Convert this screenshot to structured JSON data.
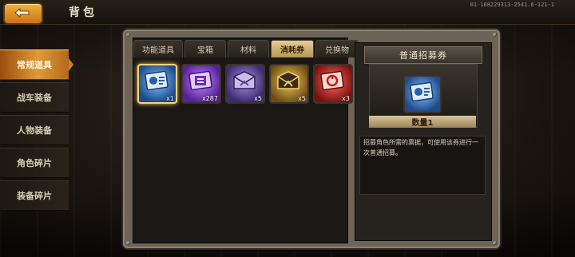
{
  "header": {
    "title": "背包",
    "server_id": "01-108229313-2541.6-121-1",
    "back_icon": "back-arrow-icon"
  },
  "sidebar": {
    "items": [
      {
        "label": "常规道具",
        "active": true
      },
      {
        "label": "战车装备",
        "active": false
      },
      {
        "label": "人物装备",
        "active": false
      },
      {
        "label": "角色碎片",
        "active": false
      },
      {
        "label": "装备碎片",
        "active": false
      }
    ]
  },
  "tabs": [
    {
      "label": "功能道具",
      "active": false
    },
    {
      "label": "宝箱",
      "active": false
    },
    {
      "label": "材料",
      "active": false
    },
    {
      "label": "消耗券",
      "active": true
    },
    {
      "label": "兑换物",
      "active": false
    }
  ],
  "items": [
    {
      "icon": "blue-ticket-icon",
      "quantity": "x1",
      "color": "#4a8ee0",
      "selected": true
    },
    {
      "icon": "purple-ticket-icon",
      "quantity": "x287",
      "color": "#8a3fd8",
      "selected": false
    },
    {
      "icon": "purple-envelope-icon",
      "quantity": "x5",
      "color": "#6f58b8",
      "selected": false
    },
    {
      "icon": "gold-envelope-icon",
      "quantity": "x5",
      "color": "#c8962e",
      "selected": false
    },
    {
      "icon": "red-ticket-icon",
      "quantity": "x3",
      "color": "#c82a20",
      "selected": false
    }
  ],
  "detail": {
    "title": "普通招募券",
    "quantity_label": "数量1",
    "description": "招募角色所需的票据，可使用该券进行一次普通招募。",
    "icon": "blue-ticket-icon"
  },
  "colors": {
    "accent": "#e09a36",
    "tab_active": "#d9bb7a",
    "selected_border": "#f5d27a"
  }
}
